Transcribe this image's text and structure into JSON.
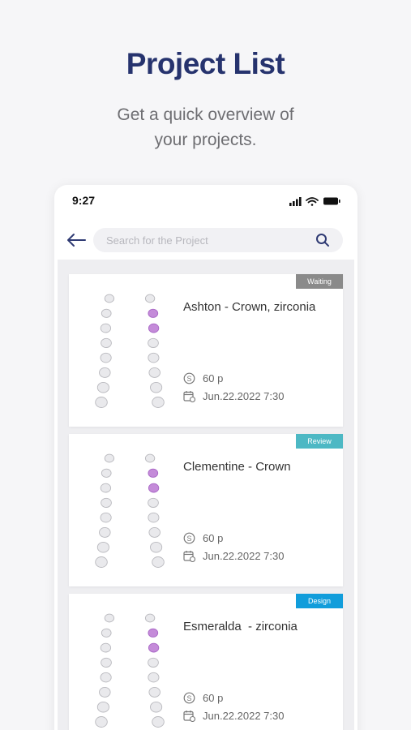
{
  "hero": {
    "title": "Project List",
    "subtitle_line1": "Get a quick overview of",
    "subtitle_line2": "your projects."
  },
  "status_bar": {
    "time": "9:27",
    "icons": [
      "signal-icon",
      "wifi-icon",
      "battery-icon"
    ]
  },
  "search": {
    "placeholder": "Search for the Project",
    "value": ""
  },
  "colors": {
    "title": "#26336e",
    "badge_waiting": "#8a8a8a",
    "badge_review": "#4db8c4",
    "badge_design": "#119ddb",
    "tooth_highlight": "#c48bd9"
  },
  "projects": [
    {
      "title": "Ashton - Crown, zirconia",
      "status": "Waiting",
      "points": "60 p",
      "date": "Jun.22.2022 7:30"
    },
    {
      "title": "Clementine - Crown",
      "status": "Review",
      "points": "60 p",
      "date": "Jun.22.2022 7:30"
    },
    {
      "title": "Esmeralda  - zirconia",
      "status": "Design",
      "points": "60 p",
      "date": "Jun.22.2022 7:30"
    }
  ]
}
